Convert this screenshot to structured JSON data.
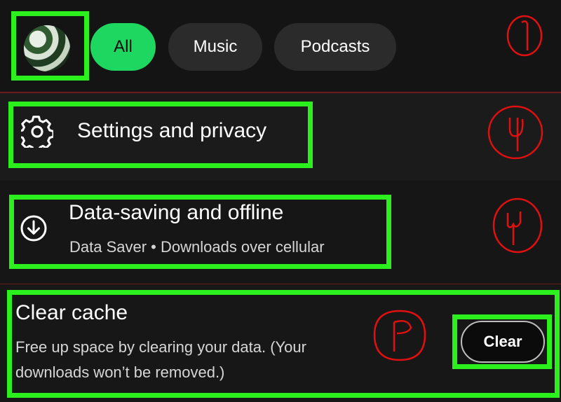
{
  "filters": {
    "chips": [
      {
        "label": "All",
        "selected": true
      },
      {
        "label": "Music",
        "selected": false
      },
      {
        "label": "Podcasts",
        "selected": false
      }
    ]
  },
  "settings": {
    "title": "Settings and privacy",
    "icon": "gear-icon"
  },
  "data_saving": {
    "title": "Data-saving and offline",
    "subtitle": "Data Saver • Downloads over cellular",
    "icon": "download-circle-icon"
  },
  "cache": {
    "title": "Clear cache",
    "description_line1": "Free up space by clearing your data. (Your",
    "description_line2": "downloads won’t be removed.)",
    "button_label": "Clear"
  },
  "colors": {
    "highlight": "#2cf01d",
    "accent": "#1ed760",
    "annotation": "#e01010"
  },
  "annotations": [
    {
      "label": "1",
      "target": "filter-bar"
    },
    {
      "label": "4",
      "target": "settings-row"
    },
    {
      "label": "3",
      "target": "data-saving-row"
    },
    {
      "label": "2",
      "target": "clear-cache-row"
    }
  ]
}
